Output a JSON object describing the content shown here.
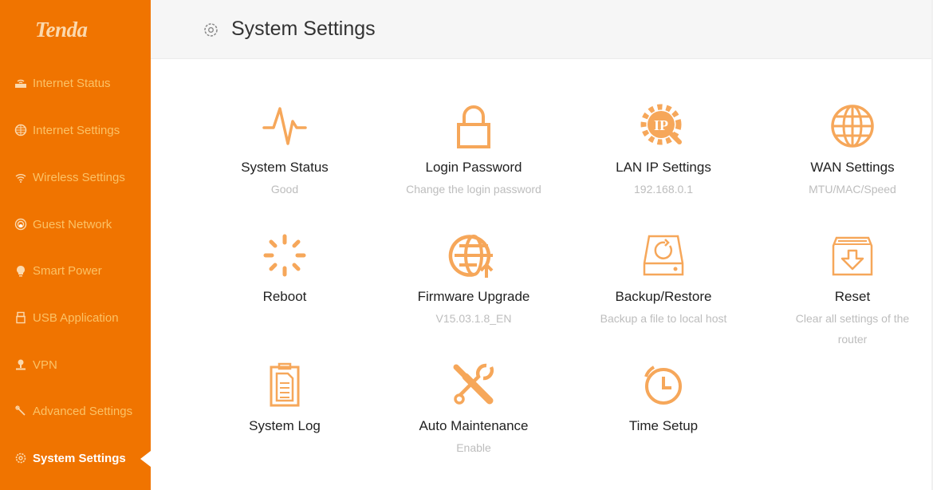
{
  "brand": {
    "logo_text": "Tenda",
    "accent": "#f07400",
    "icon_color": "#f6a75a"
  },
  "sidebar": {
    "items": [
      {
        "label": "Internet Status",
        "icon": "router-icon"
      },
      {
        "label": "Internet Settings",
        "icon": "globe-icon"
      },
      {
        "label": "Wireless Settings",
        "icon": "wifi-icon"
      },
      {
        "label": "Guest Network",
        "icon": "guest-network-icon"
      },
      {
        "label": "Smart Power",
        "icon": "bulb-icon"
      },
      {
        "label": "USB Application",
        "icon": "usb-icon"
      },
      {
        "label": "VPN",
        "icon": "vpn-icon"
      },
      {
        "label": "Advanced Settings",
        "icon": "wrench-icon"
      },
      {
        "label": "System Settings",
        "icon": "gear-icon",
        "active": true
      }
    ]
  },
  "header": {
    "title": "System Settings",
    "icon": "gear-icon"
  },
  "tiles": [
    {
      "name": "System Status",
      "desc": "Good",
      "icon": "pulse-icon"
    },
    {
      "name": "Login Password",
      "desc": "Change the login password",
      "icon": "lock-icon"
    },
    {
      "name": "LAN IP Settings",
      "desc": "192.168.0.1",
      "icon": "ip-gear-icon"
    },
    {
      "name": "WAN Settings",
      "desc": "MTU/MAC/Speed",
      "icon": "globe-icon"
    },
    {
      "name": "Reboot",
      "desc": "",
      "icon": "spinner-icon"
    },
    {
      "name": "Firmware Upgrade",
      "desc": "V15.03.1.8_EN",
      "icon": "globe-upload-icon"
    },
    {
      "name": "Backup/Restore",
      "desc": "Backup a file to local host",
      "icon": "disk-restore-icon"
    },
    {
      "name": "Reset",
      "desc": "Clear all settings of the router",
      "icon": "box-download-icon"
    },
    {
      "name": "System Log",
      "desc": "",
      "icon": "clipboard-icon"
    },
    {
      "name": "Auto Maintenance",
      "desc": "Enable",
      "icon": "tools-icon"
    },
    {
      "name": "Time Setup",
      "desc": "",
      "icon": "clock-icon"
    }
  ]
}
